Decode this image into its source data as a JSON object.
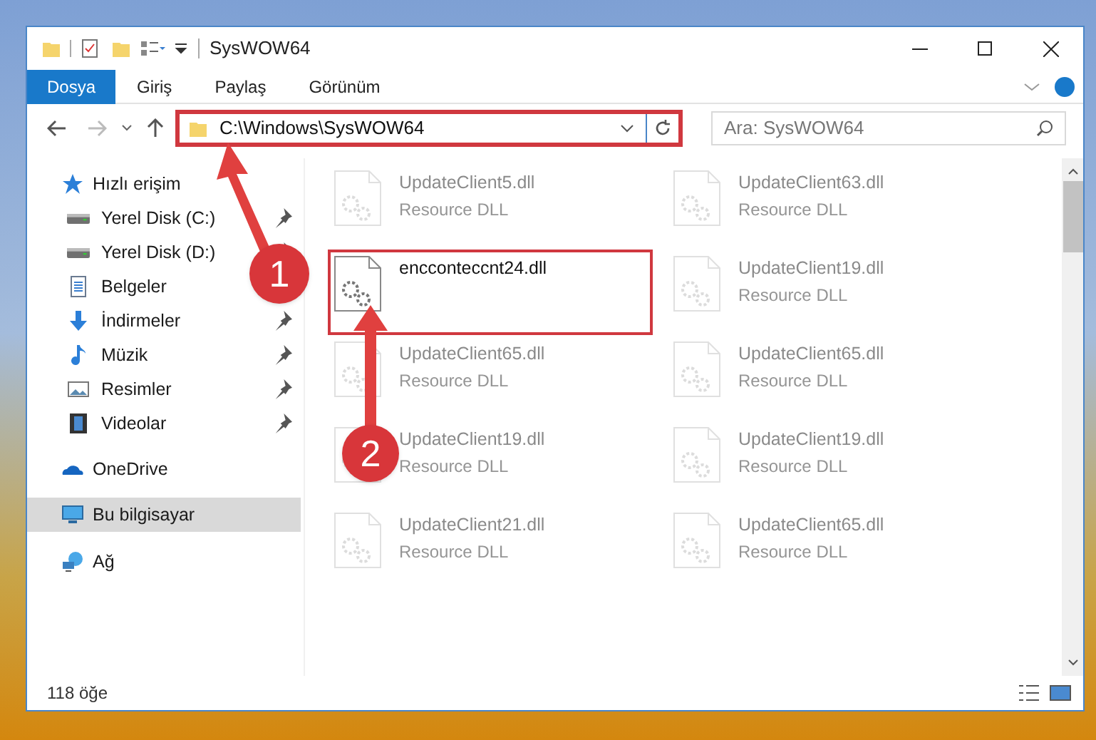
{
  "window": {
    "title": "SysWOW64"
  },
  "ribbon_tabs": [
    {
      "label": "Dosya",
      "selected": true
    },
    {
      "label": "Giriş",
      "selected": false
    },
    {
      "label": "Paylaş",
      "selected": false
    },
    {
      "label": "Görünüm",
      "selected": false
    }
  ],
  "address": {
    "path": "C:\\Windows\\SysWOW64",
    "highlighted": true
  },
  "search": {
    "placeholder": "Ara: SysWOW64"
  },
  "sidebar": {
    "items": [
      {
        "label": "Hızlı erişim",
        "kind": "star",
        "selected": false,
        "children": [
          {
            "label": "Yerel Disk (C:)",
            "kind": "drive",
            "pinned": true,
            "selected": false
          },
          {
            "label": "Yerel Disk (D:)",
            "kind": "drive",
            "pinned": true,
            "selected": false
          },
          {
            "label": "Belgeler",
            "kind": "document",
            "selected": false
          },
          {
            "label": "İndirmeler",
            "kind": "download",
            "pinned": true,
            "selected": false
          },
          {
            "label": "Müzik",
            "kind": "music",
            "pinned": true,
            "selected": false
          },
          {
            "label": "Resimler",
            "kind": "pictures",
            "pinned": true,
            "selected": false
          },
          {
            "label": "Videolar",
            "kind": "video",
            "pinned": true,
            "selected": false
          }
        ]
      },
      {
        "label": "OneDrive",
        "kind": "cloud",
        "selected": false
      },
      {
        "label": "Bu bilgisayar",
        "kind": "computer",
        "selected": true
      },
      {
        "label": "Ağ",
        "kind": "network",
        "selected": false
      }
    ]
  },
  "files": [
    {
      "name": "UpdateClient5.dll",
      "type": "Resource DLL",
      "faded": true,
      "highlighted": false
    },
    {
      "name": "UpdateClient63.dll",
      "type": "Resource DLL",
      "faded": true,
      "highlighted": false
    },
    {
      "name": "encconteccnt24.dll",
      "faded": false,
      "highlighted": true
    },
    {
      "name": "UpdateClient19.dll",
      "type": "Resource DLL",
      "faded": true,
      "highlighted": false
    },
    {
      "name": "UpdateClient65.dll",
      "type": "Resource DLL",
      "faded": true,
      "highlighted": false
    },
    {
      "name": "UpdateClient65.dll",
      "type": "Resource DLL",
      "faded": true,
      "highlighted": false
    },
    {
      "name": "UpdateClient19.dll",
      "type": "Resource DLL",
      "faded": true,
      "highlighted": false
    },
    {
      "name": "UpdateClient19.dll",
      "type": "Resource DLL",
      "faded": true,
      "highlighted": false
    },
    {
      "name": "UpdateClient21.dll",
      "type": "Resource DLL",
      "faded": true,
      "highlighted": false
    },
    {
      "name": "UpdateClient65.dll",
      "type": "Resource DLL",
      "faded": true,
      "highlighted": false
    }
  ],
  "status_bar": {
    "count": "118 öğe"
  },
  "annotations": [
    "1",
    "2"
  ]
}
